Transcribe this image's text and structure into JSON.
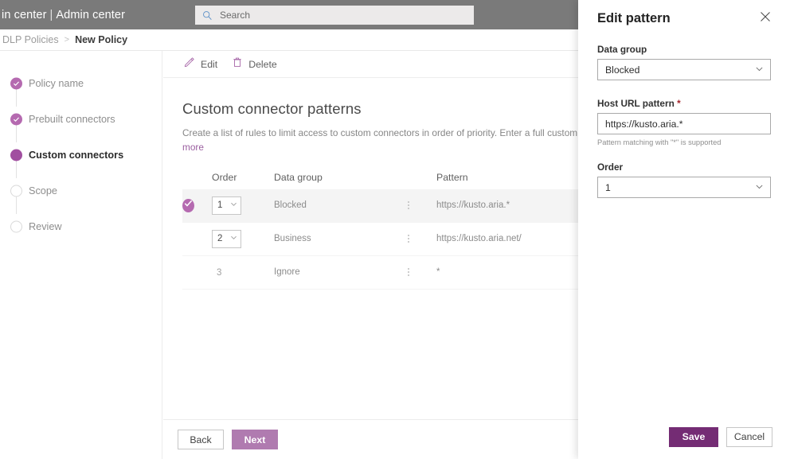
{
  "suite": {
    "title_prefix": "in center",
    "separator": "|",
    "title_suffix": "Admin center",
    "search_placeholder": "Search"
  },
  "breadcrumb": {
    "parent": "DLP Policies",
    "separator": ">",
    "current": "New Policy"
  },
  "stepper": {
    "items": [
      {
        "label": "Policy name",
        "state": "done"
      },
      {
        "label": "Prebuilt connectors",
        "state": "done"
      },
      {
        "label": "Custom connectors",
        "state": "active"
      },
      {
        "label": "Scope",
        "state": "todo"
      },
      {
        "label": "Review",
        "state": "todo"
      }
    ]
  },
  "commandbar": {
    "edit_label": "Edit",
    "delete_label": "Delete"
  },
  "page": {
    "title": "Custom connector patterns",
    "description": "Create a list of rules to limit access to custom connectors in order of priority. Enter a full custom connector U",
    "more_link": "more"
  },
  "table": {
    "headers": {
      "order": "Order",
      "data_group": "Data group",
      "pattern": "Pattern"
    },
    "rows": [
      {
        "order": "1",
        "order_is_select": true,
        "data_group": "Blocked",
        "pattern": "https://kusto.aria.*",
        "selected": true
      },
      {
        "order": "2",
        "order_is_select": true,
        "data_group": "Business",
        "pattern": "https://kusto.aria.net/",
        "selected": false
      },
      {
        "order": "3",
        "order_is_select": false,
        "data_group": "Ignore",
        "pattern": "*",
        "selected": false
      }
    ]
  },
  "wizard_footer": {
    "back_label": "Back",
    "next_label": "Next"
  },
  "panel": {
    "title": "Edit pattern",
    "data_group": {
      "label": "Data group",
      "value": "Blocked"
    },
    "host_url": {
      "label": "Host URL pattern",
      "required_mark": "*",
      "value": "https://kusto.aria.*",
      "hint": "Pattern matching with \"*\" is supported"
    },
    "order": {
      "label": "Order",
      "value": "1"
    },
    "save_label": "Save",
    "cancel_label": "Cancel"
  },
  "colors": {
    "accent_purple": "#742c74",
    "accent_purple_muted": "#b07bb0",
    "step_done": "#b56ab0",
    "suite_bar": "#7a7a7a"
  }
}
